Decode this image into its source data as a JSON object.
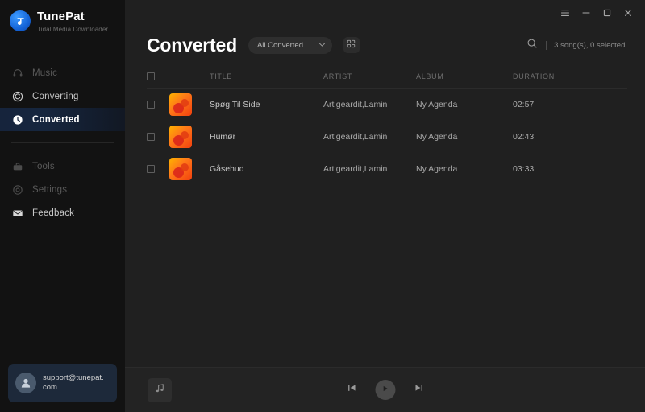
{
  "brand": {
    "title": "TunePat",
    "subtitle": "Tidal Media Downloader",
    "logo_icon": "tunepat-logo-icon"
  },
  "window_controls": {
    "menu_label": "☰",
    "minimize_label": "–",
    "maximize_label": "□",
    "close_label": "✕"
  },
  "sidebar": {
    "items": [
      {
        "label": "Music",
        "icon": "headphones-icon",
        "state": "dim"
      },
      {
        "label": "Converting",
        "icon": "converting-icon",
        "state": "normal"
      },
      {
        "label": "Converted",
        "icon": "clock-icon",
        "state": "active"
      },
      {
        "label": "Tools",
        "icon": "toolbox-icon",
        "state": "dim"
      },
      {
        "label": "Settings",
        "icon": "gear-icon",
        "state": "dim"
      },
      {
        "label": "Feedback",
        "icon": "envelope-icon",
        "state": "normal"
      }
    ],
    "account": {
      "email": "support@tunepat.com",
      "avatar_icon": "user-avatar-icon"
    }
  },
  "header": {
    "title": "Converted",
    "filter": {
      "selected": "All Converted",
      "options": [
        "All Converted"
      ],
      "chevron_icon": "chevron-down-icon"
    },
    "grid_toggle_icon": "grid-view-icon",
    "search_icon": "search-icon",
    "count_text": "3 song(s), 0 selected."
  },
  "table": {
    "columns": [
      "TITLE",
      "ARTIST",
      "ALBUM",
      "DURATION"
    ],
    "select_all_checked": false,
    "rows": [
      {
        "checked": false,
        "title": "Spøg Til Side",
        "artist": "Artigeardit,Lamin",
        "album": "Ny Agenda",
        "duration": "02:57"
      },
      {
        "checked": false,
        "title": "Humør",
        "artist": "Artigeardit,Lamin",
        "album": "Ny Agenda",
        "duration": "02:43"
      },
      {
        "checked": false,
        "title": "Gåsehud",
        "artist": "Artigeardit,Lamin",
        "album": "Ny Agenda",
        "duration": "03:33"
      }
    ]
  },
  "player": {
    "artwork_icon": "music-note-icon",
    "previous_icon": "previous-track-icon",
    "play_icon": "play-icon",
    "next_icon": "next-track-icon"
  },
  "colors": {
    "sidebar_bg": "#121212",
    "main_bg": "#202020",
    "player_bg": "#232323",
    "accent_blue": "#1565d8",
    "active_nav": "#16243c",
    "account_bg": "#1d293a",
    "artwork_orange": "#ff7a18"
  }
}
